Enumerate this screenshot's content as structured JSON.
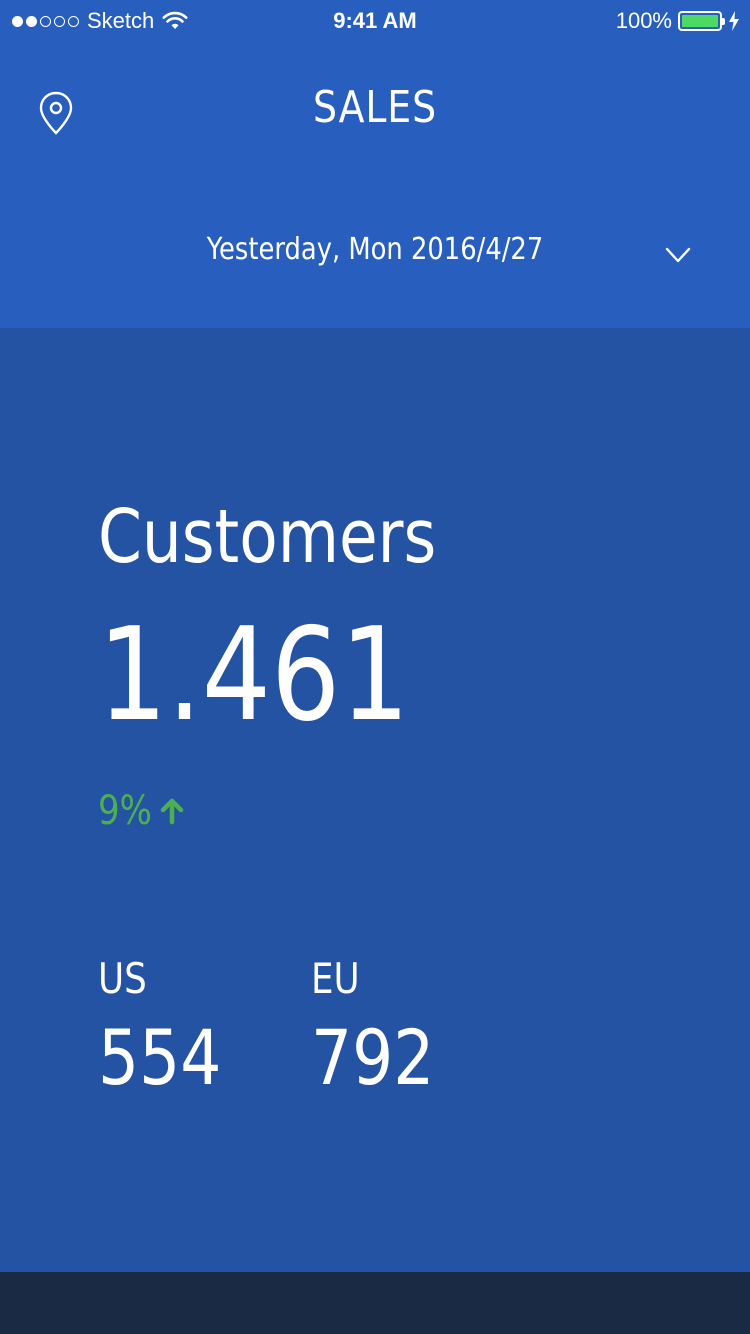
{
  "status_bar": {
    "carrier": "Sketch",
    "time": "9:41 AM",
    "battery": "100%",
    "signal_bars_filled": 2,
    "signal_bars_total": 5
  },
  "header": {
    "title": "SALES",
    "date": "Yesterday, Mon 2016/4/27",
    "location_icon": "location-pin-icon",
    "dropdown_icon": "chevron-down-icon"
  },
  "metric": {
    "label": "Customers",
    "value": "1.461",
    "change": "9%",
    "change_direction": "up"
  },
  "regions": [
    {
      "name": "US",
      "value": "554"
    },
    {
      "name": "EU",
      "value": "792"
    }
  ],
  "colors": {
    "header_bg": "#285fbe",
    "body_bg": "#2453a3",
    "footer_bg": "#1a2a45",
    "positive": "#4caf50",
    "battery": "#4cd964"
  }
}
